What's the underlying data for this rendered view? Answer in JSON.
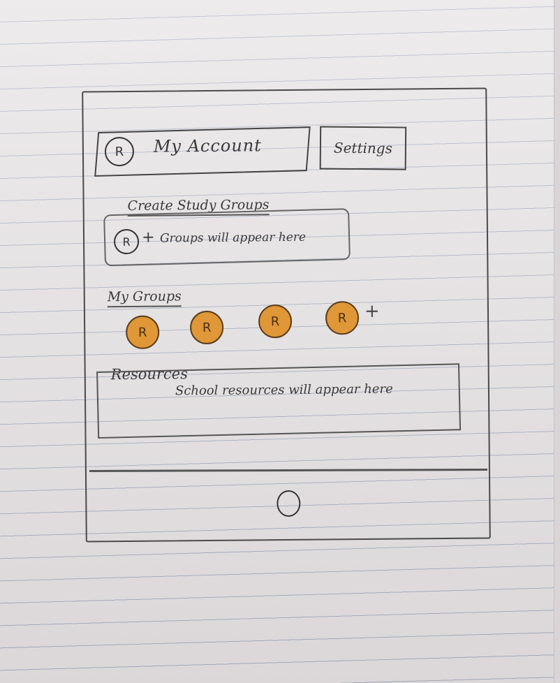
{
  "header": {
    "avatar_glyph": "R",
    "account_label": "My Account",
    "settings_label": "Settings"
  },
  "create_groups": {
    "title": "Create Study Groups",
    "avatar_glyph": "R",
    "plus_glyph": "+",
    "hint": "Groups will appear here"
  },
  "my_groups": {
    "title": "My Groups",
    "groups": [
      {
        "glyph": "R"
      },
      {
        "glyph": "R"
      },
      {
        "glyph": "R"
      },
      {
        "glyph": "R"
      }
    ],
    "add_glyph": "+",
    "accent_color": "#df9738"
  },
  "resources": {
    "title": "Resources",
    "hint": "School resources will appear here"
  },
  "icons": {
    "account": "user-icon",
    "groups": "user-icon",
    "home": "home-button-icon"
  }
}
